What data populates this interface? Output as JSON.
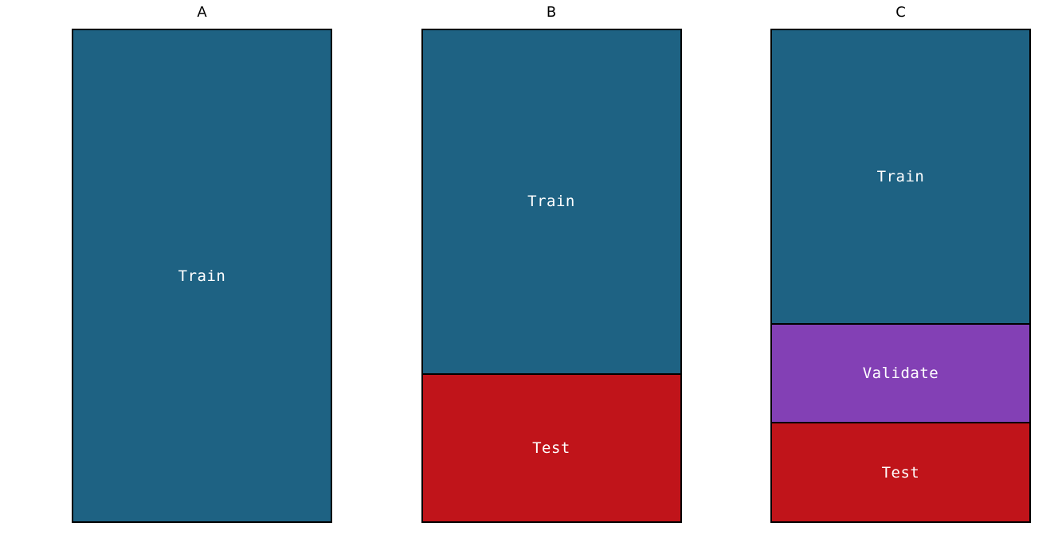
{
  "chart_data": [
    {
      "type": "bar",
      "title": "A",
      "ylim": [
        0,
        1
      ],
      "series": [
        {
          "name": "Train",
          "value": 1.0,
          "color": "#1e6283"
        }
      ]
    },
    {
      "type": "bar",
      "title": "B",
      "ylim": [
        0,
        1
      ],
      "series": [
        {
          "name": "Train",
          "value": 0.7,
          "color": "#1e6283"
        },
        {
          "name": "Test",
          "value": 0.3,
          "color": "#c0141a"
        }
      ]
    },
    {
      "type": "bar",
      "title": "C",
      "ylim": [
        0,
        1
      ],
      "series": [
        {
          "name": "Train",
          "value": 0.6,
          "color": "#1e6283"
        },
        {
          "name": "Validate",
          "value": 0.2,
          "color": "#8340b5"
        },
        {
          "name": "Test",
          "value": 0.2,
          "color": "#c0141a"
        }
      ]
    }
  ],
  "panels": {
    "a": {
      "title": "A",
      "segments": {
        "train": "Train"
      }
    },
    "b": {
      "title": "B",
      "segments": {
        "train": "Train",
        "test": "Test"
      }
    },
    "c": {
      "title": "C",
      "segments": {
        "train": "Train",
        "validate": "Validate",
        "test": "Test"
      }
    }
  }
}
